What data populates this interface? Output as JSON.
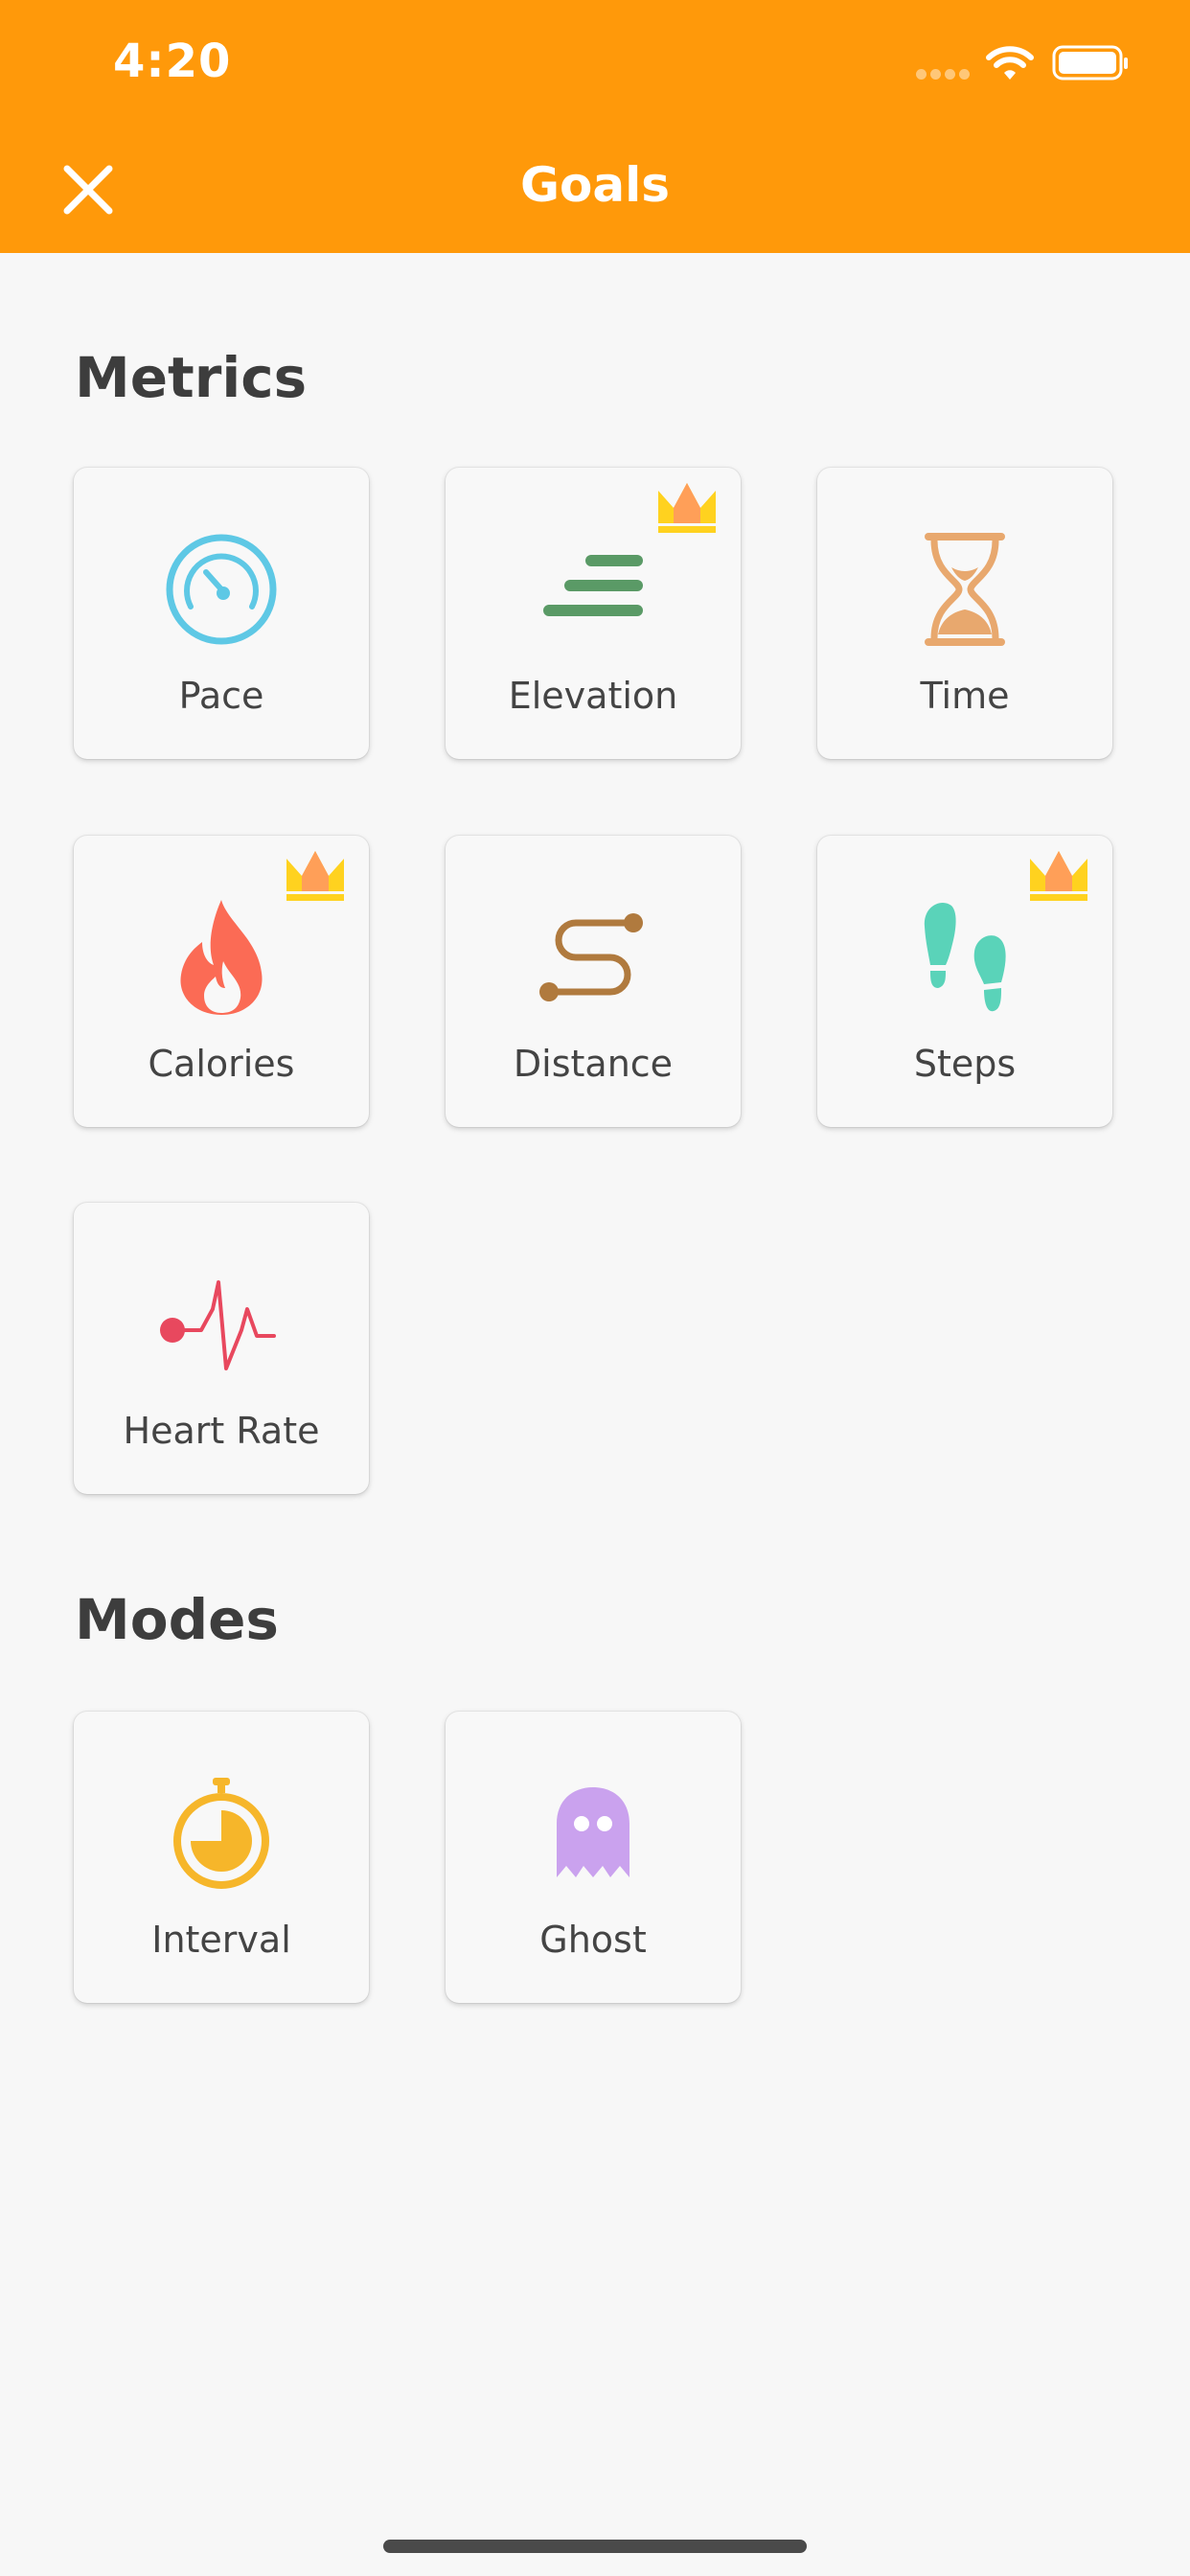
{
  "status_bar": {
    "time": "4:20"
  },
  "header": {
    "title": "Goals",
    "close_icon": "close-icon"
  },
  "sections": {
    "metrics": {
      "title": "Metrics",
      "items": [
        {
          "label": "Pace",
          "icon": "speedometer-icon",
          "premium": false,
          "color": "#5ec8e5"
        },
        {
          "label": "Elevation",
          "icon": "elevation-icon",
          "premium": true,
          "color": "#5a9a66"
        },
        {
          "label": "Time",
          "icon": "hourglass-icon",
          "premium": false,
          "color": "#e8a86e"
        },
        {
          "label": "Calories",
          "icon": "flame-icon",
          "premium": true,
          "color": "#fb6b55"
        },
        {
          "label": "Distance",
          "icon": "route-icon",
          "premium": false,
          "color": "#b07a3e"
        },
        {
          "label": "Steps",
          "icon": "footprints-icon",
          "premium": true,
          "color": "#5ad3b9"
        },
        {
          "label": "Heart Rate",
          "icon": "heart-rate-icon",
          "premium": false,
          "color": "#e8485e"
        }
      ]
    },
    "modes": {
      "title": "Modes",
      "items": [
        {
          "label": "Interval",
          "icon": "stopwatch-icon",
          "premium": false,
          "color": "#f6b62a"
        },
        {
          "label": "Ghost",
          "icon": "ghost-icon",
          "premium": false,
          "color": "#caa2ee"
        }
      ]
    }
  },
  "colors": {
    "header": "#ff990a",
    "background": "#f7f7f7",
    "crown": "#ffd21f"
  }
}
